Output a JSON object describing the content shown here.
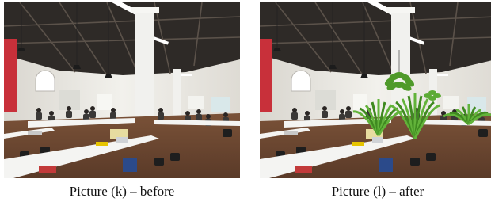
{
  "figure": {
    "panels": [
      {
        "id": "k",
        "caption": "Picture (k) – before",
        "plants": false
      },
      {
        "id": "l",
        "caption": "Picture (l) – after",
        "plants": true
      }
    ],
    "colors": {
      "ceiling": "#2e2a27",
      "wall": "#e6e4df",
      "floor": "#5a3a28",
      "desk": "#f4f4f2",
      "column": "#f1f1ee",
      "red_banner": "#c8303a",
      "plant_green": "#4f9a2a"
    }
  }
}
